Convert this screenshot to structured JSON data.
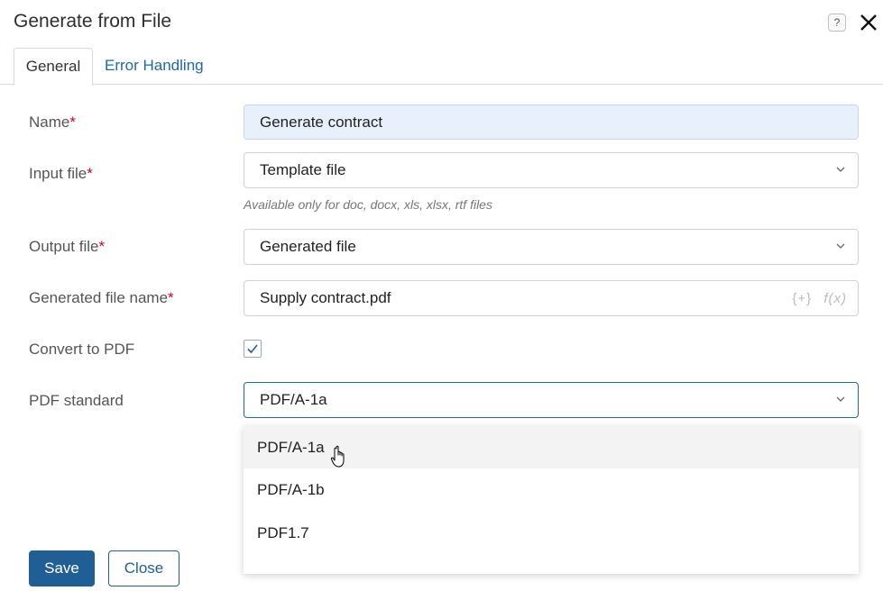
{
  "dialog": {
    "title": "Generate from File",
    "help_label": "?"
  },
  "tabs": [
    {
      "label": "General",
      "active": true
    },
    {
      "label": "Error Handling",
      "active": false
    }
  ],
  "form": {
    "required_mark": "*",
    "name": {
      "label": "Name",
      "value": "Generate contract"
    },
    "input_file": {
      "label": "Input file",
      "value": "Template file",
      "hint": "Available only for doc, docx, xls, xlsx, rtf files"
    },
    "output_file": {
      "label": "Output file",
      "value": "Generated file"
    },
    "generated_file_name": {
      "label": "Generated file name",
      "value": "Supply contract.pdf",
      "insert_icon": "{+}",
      "function_icon": "f(x)"
    },
    "convert_to_pdf": {
      "label": "Convert to PDF",
      "checked": true
    },
    "pdf_standard": {
      "label": "PDF standard",
      "value": "PDF/A-1a",
      "options": [
        "PDF/A-1a",
        "PDF/A-1b",
        "PDF1.7"
      ],
      "hovered_option": "PDF/A-1a"
    }
  },
  "footer": {
    "save_label": "Save",
    "close_label": "Close"
  },
  "colors": {
    "accent": "#1f5f96",
    "link": "#1f6aa5",
    "required": "#d0021b",
    "name_field_bg": "#e8f0fb"
  }
}
